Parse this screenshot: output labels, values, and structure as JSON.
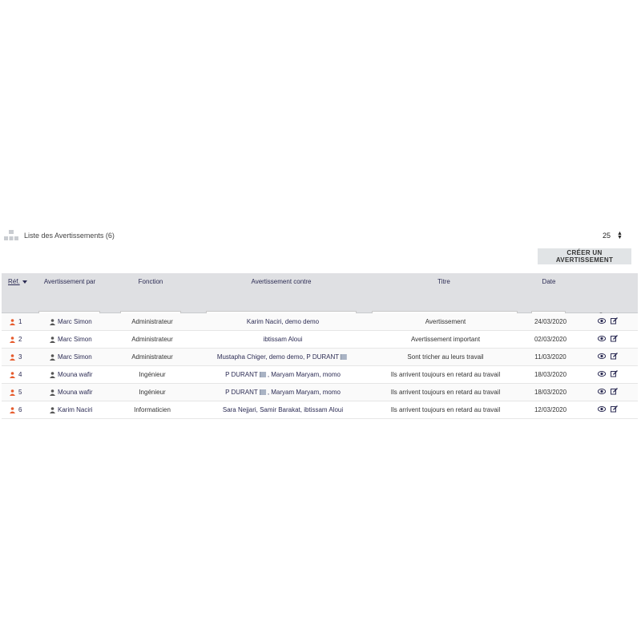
{
  "header": {
    "title": "Liste des Avertissements",
    "count": "(6)",
    "per_page": "25",
    "create_button": "Créer un avertissement"
  },
  "columns": {
    "ref": "Réf.",
    "by": "Avertissement par",
    "function": "Fonction",
    "against": "Avertissement contre",
    "title": "Titre",
    "date": "Date"
  },
  "icons": {
    "list": "list-icon",
    "user_ref": "user-warning-icon",
    "user": "user-icon",
    "search": "search-icon",
    "clear_filter": "clear-filter-icon",
    "view": "eye-icon",
    "edit": "edit-icon",
    "doc": "document-icon"
  },
  "colors": {
    "accent": "#e65c2e",
    "link": "#2c2c54",
    "header_bg": "#dfe0e3"
  },
  "rows": [
    {
      "ref": "1",
      "by": "Marc Simon",
      "function": "Administrateur",
      "against": "Karim Naciri, demo demo",
      "title": "Avertissement",
      "date": "24/03/2020"
    },
    {
      "ref": "2",
      "by": "Marc Simon",
      "function": "Administrateur",
      "against": "ibtissam Aloui",
      "title": "Avertissement important",
      "date": "02/03/2020"
    },
    {
      "ref": "3",
      "by": "Marc Simon",
      "function": "Administrateur",
      "against_a": "Mustapha Chiger, demo demo, P DURANT",
      "title": "Sont tricher au leurs travail",
      "date": "11/03/2020"
    },
    {
      "ref": "4",
      "by": "Mouna wafir",
      "function": "Ingénieur",
      "against_a": "P DURANT",
      "against_b": ", Maryam Maryam, momo",
      "title": "Ils arrivent toujours en retard au travail",
      "date": "18/03/2020"
    },
    {
      "ref": "5",
      "by": "Mouna wafir",
      "function": "Ingénieur",
      "against_a": "P DURANT",
      "against_b": ", Maryam Maryam, momo",
      "title": "Ils arrivent toujours en retard au travail",
      "date": "18/03/2020"
    },
    {
      "ref": "6",
      "by": "Karim Naciri",
      "function": "Informaticien",
      "against": "Sara Nejjari, Samir Barakat, ibtissam Aloui",
      "title": "Ils arrivent toujours en retard au travail",
      "date": "12/03/2020"
    }
  ]
}
